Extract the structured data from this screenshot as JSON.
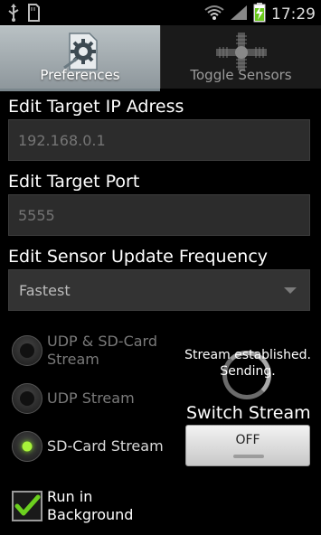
{
  "status_bar": {
    "time": "17:29",
    "icons": [
      "usb-icon",
      "sd-card-icon",
      "wifi-icon",
      "signal-icon",
      "battery-charging-icon"
    ]
  },
  "tabs": [
    {
      "label": "Preferences",
      "icon": "preferences-gear-icon",
      "active": true
    },
    {
      "label": "Toggle Sensors",
      "icon": "toggle-sensors-icon",
      "active": false
    }
  ],
  "target_ip": {
    "label": "Edit Target IP Adress",
    "placeholder": "192.168.0.1",
    "value": ""
  },
  "target_port": {
    "label": "Edit Target Port",
    "placeholder": "5555",
    "value": ""
  },
  "update_frequency": {
    "label": "Edit Sensor Update Frequency",
    "selected": "Fastest"
  },
  "stream_mode": {
    "options": [
      {
        "label": "UDP & SD-Card Stream",
        "checked": false,
        "enabled": false
      },
      {
        "label": "UDP Stream",
        "checked": false,
        "enabled": false
      },
      {
        "label": "SD-Card Stream",
        "checked": true,
        "enabled": true
      }
    ]
  },
  "stream_panel": {
    "status": "Stream established. Sending.",
    "switch_label": "Switch Stream",
    "toggle_state": "OFF"
  },
  "run_in_background": {
    "label": "Run in Background",
    "checked": true
  },
  "colors": {
    "accent_green": "#a8f33a",
    "check_green": "#6cd01f",
    "background": "#000000",
    "field_bg": "#2c2c2c"
  }
}
